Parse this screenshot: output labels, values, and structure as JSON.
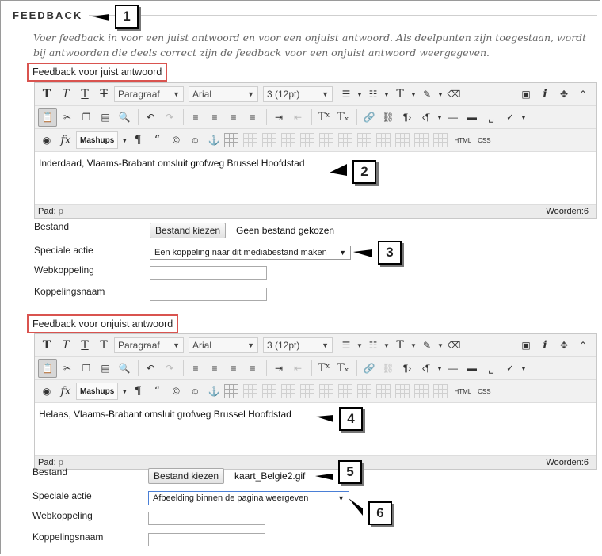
{
  "section_header": "FEEDBACK",
  "instruction": "Voer feedback in voor een juist antwoord en voor een onjuist antwoord. Als deelpunten zijn toegestaan, wordt bij antwoorden die deels correct zijn de feedback voor een onjuist antwoord weergegeven.",
  "toolbar": {
    "paragraph": "Paragraaf",
    "font": "Arial",
    "size": "3 (12pt)",
    "mashups": "Mashups",
    "html": "HTML",
    "css": "CSS"
  },
  "correct": {
    "label": "Feedback voor juist antwoord",
    "content": "Inderdaad, Vlaams-Brabant omsluit grofweg Brussel Hoofdstad",
    "path_label": "Pad:",
    "path_value": "p",
    "words": "Woorden:6",
    "file_label": "Bestand",
    "file_button": "Bestand kiezen",
    "file_status": "Geen bestand gekozen",
    "action_label": "Speciale actie",
    "action_value": "Een koppeling naar dit mediabestand maken",
    "weblink_label": "Webkoppeling",
    "linkname_label": "Koppelingsnaam"
  },
  "incorrect": {
    "label": "Feedback voor onjuist antwoord",
    "content": "Helaas, Vlaams-Brabant omsluit grofweg Brussel Hoofdstad",
    "path_label": "Pad:",
    "path_value": "p",
    "words": "Woorden:6",
    "file_label": "Bestand",
    "file_button": "Bestand kiezen",
    "file_status": "kaart_Belgie2.gif",
    "action_label": "Speciale actie",
    "action_value": "Afbeelding binnen de pagina weergeven",
    "weblink_label": "Webkoppeling",
    "linkname_label": "Koppelingsnaam"
  },
  "callouts": [
    "1",
    "2",
    "3",
    "4",
    "5",
    "6"
  ]
}
